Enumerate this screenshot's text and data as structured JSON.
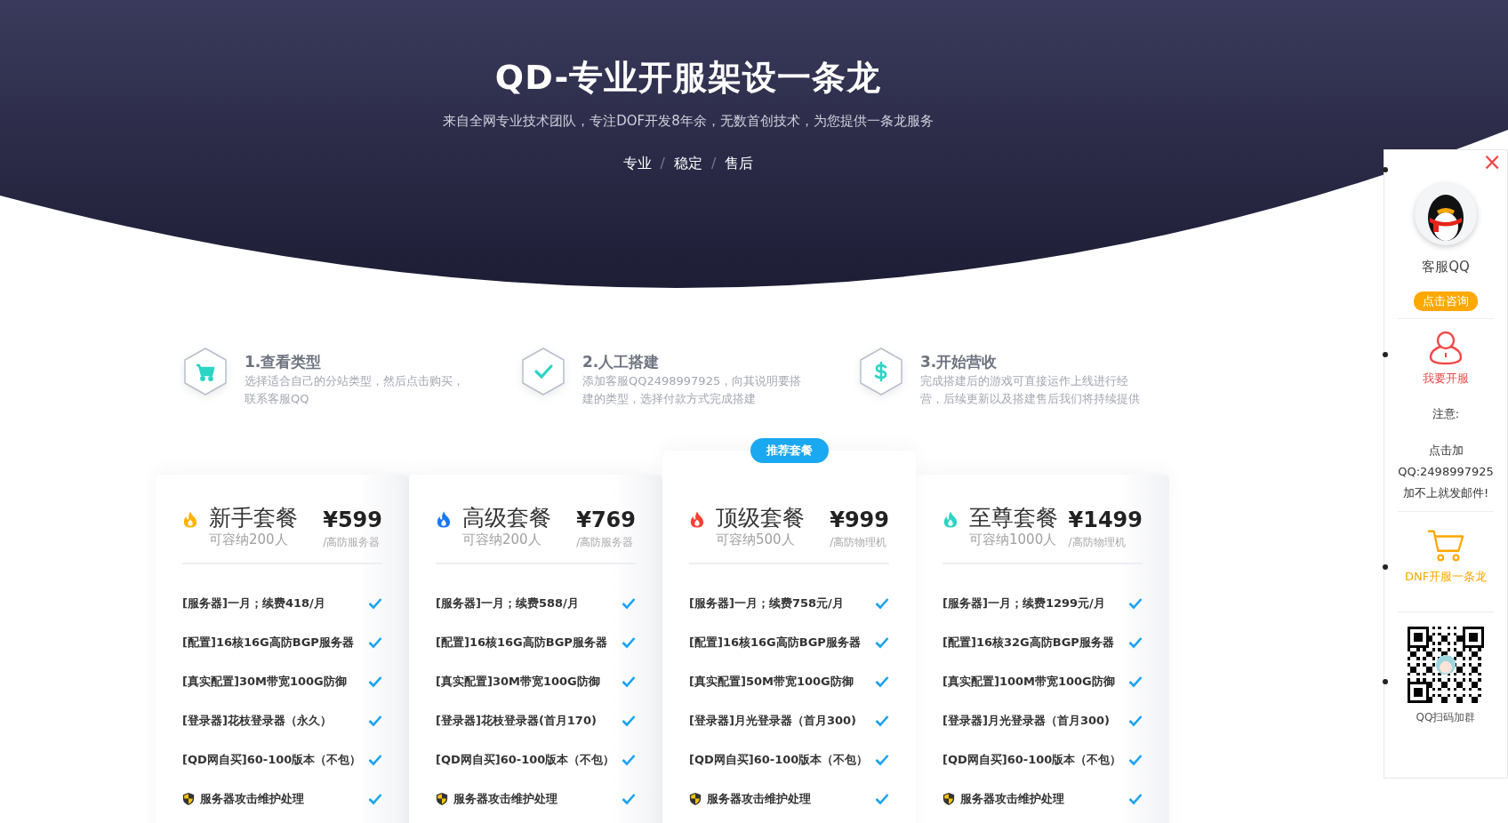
{
  "hero": {
    "title": "QD-专业开服架设一条龙",
    "subtitle": "来自全网专业技术团队，专注DOF开发8年余，无数首创技术，为您提供一条龙服务",
    "tags": [
      "专业",
      "稳定",
      "售后"
    ],
    "separator": "/"
  },
  "steps": [
    {
      "kind": "cart",
      "title": "1.查看类型",
      "text": "选择适合自己的分站类型，然后点击购买，联系客服QQ"
    },
    {
      "kind": "check",
      "title": "2.人工搭建",
      "text": "添加客服QQ2498997925，向其说明要搭建的类型，选择付款方式完成搭建"
    },
    {
      "kind": "dollar",
      "title": "3.开始营收",
      "text": "完成搭建后的游戏可直接运作上线进行经营，后续更新以及搭建售后我们将持续提供"
    }
  ],
  "plans": [
    {
      "name": "新手套餐",
      "color": "#ffb300",
      "capacity": "可容纳200人",
      "price": "¥599",
      "unit": "/高防服务器",
      "featured": false,
      "features": [
        {
          "kind": "plain",
          "text": "[服务器]一月；续费418/月"
        },
        {
          "kind": "plain",
          "text": "[配置]16核16G高防BGP服务器"
        },
        {
          "kind": "plain",
          "text": "[真实配置]30M带宽100G防御"
        },
        {
          "kind": "plain",
          "text": "[登录器]花枝登录器（永久）"
        },
        {
          "kind": "plain",
          "text": "[QD网自买]60-100版本（不包）"
        },
        {
          "kind": "shield",
          "text": "服务器攻击维护处理"
        }
      ]
    },
    {
      "name": "高级套餐",
      "color": "#1677ff",
      "capacity": "可容纳200人",
      "price": "¥769",
      "unit": "/高防服务器",
      "featured": false,
      "features": [
        {
          "kind": "plain",
          "text": "[服务器]一月；续费588/月"
        },
        {
          "kind": "plain",
          "text": "[配置]16核16G高防BGP服务器"
        },
        {
          "kind": "plain",
          "text": "[真实配置]30M带宽100G防御"
        },
        {
          "kind": "plain",
          "text": "[登录器]花枝登录器(首月170)"
        },
        {
          "kind": "plain",
          "text": "[QD网自买]60-100版本（不包）"
        },
        {
          "kind": "shield",
          "text": "服务器攻击维护处理"
        }
      ]
    },
    {
      "name": "顶级套餐",
      "color": "#f04134",
      "capacity": "可容纳500人",
      "price": "¥999",
      "unit": "/高防物理机",
      "featured": true,
      "badge": "推荐套餐",
      "features": [
        {
          "kind": "plain",
          "text": "[服务器]一月；续费758元/月"
        },
        {
          "kind": "plain",
          "text": "[配置]16核16G高防BGP服务器"
        },
        {
          "kind": "plain",
          "text": "[真实配置]50M带宽100G防御"
        },
        {
          "kind": "plain",
          "text": "[登录器]月光登录器（首月300)"
        },
        {
          "kind": "plain",
          "text": "[QD网自买]60-100版本（不包）"
        },
        {
          "kind": "shield",
          "text": "服务器攻击维护处理"
        }
      ]
    },
    {
      "name": "至尊套餐",
      "color": "#2cd4c4",
      "capacity": "可容纳1000人",
      "price": "¥1499",
      "unit": "/高防物理机",
      "featured": false,
      "features": [
        {
          "kind": "plain",
          "text": "[服务器]一月；续费1299元/月"
        },
        {
          "kind": "plain",
          "text": "[配置]16核32G高防BGP服务器"
        },
        {
          "kind": "plain",
          "text": "[真实配置]100M带宽100G防御"
        },
        {
          "kind": "plain",
          "text": "[登录器]月光登录器（首月300)"
        },
        {
          "kind": "plain",
          "text": "[QD网自买]60-100版本（不包）"
        },
        {
          "kind": "shield",
          "text": "服务器攻击维护处理"
        }
      ]
    }
  ],
  "sidebar": {
    "close": "×",
    "qq_label": "客服QQ",
    "consult_button": "点击咨询",
    "open_label": "我要开服",
    "notice_title": "注意:",
    "notice_lines": [
      "点击加",
      "QQ:2498997925",
      "加不上就发邮件!"
    ],
    "shop_label": "DNF开服一条龙",
    "qr_label": "QQ扫码加群"
  }
}
